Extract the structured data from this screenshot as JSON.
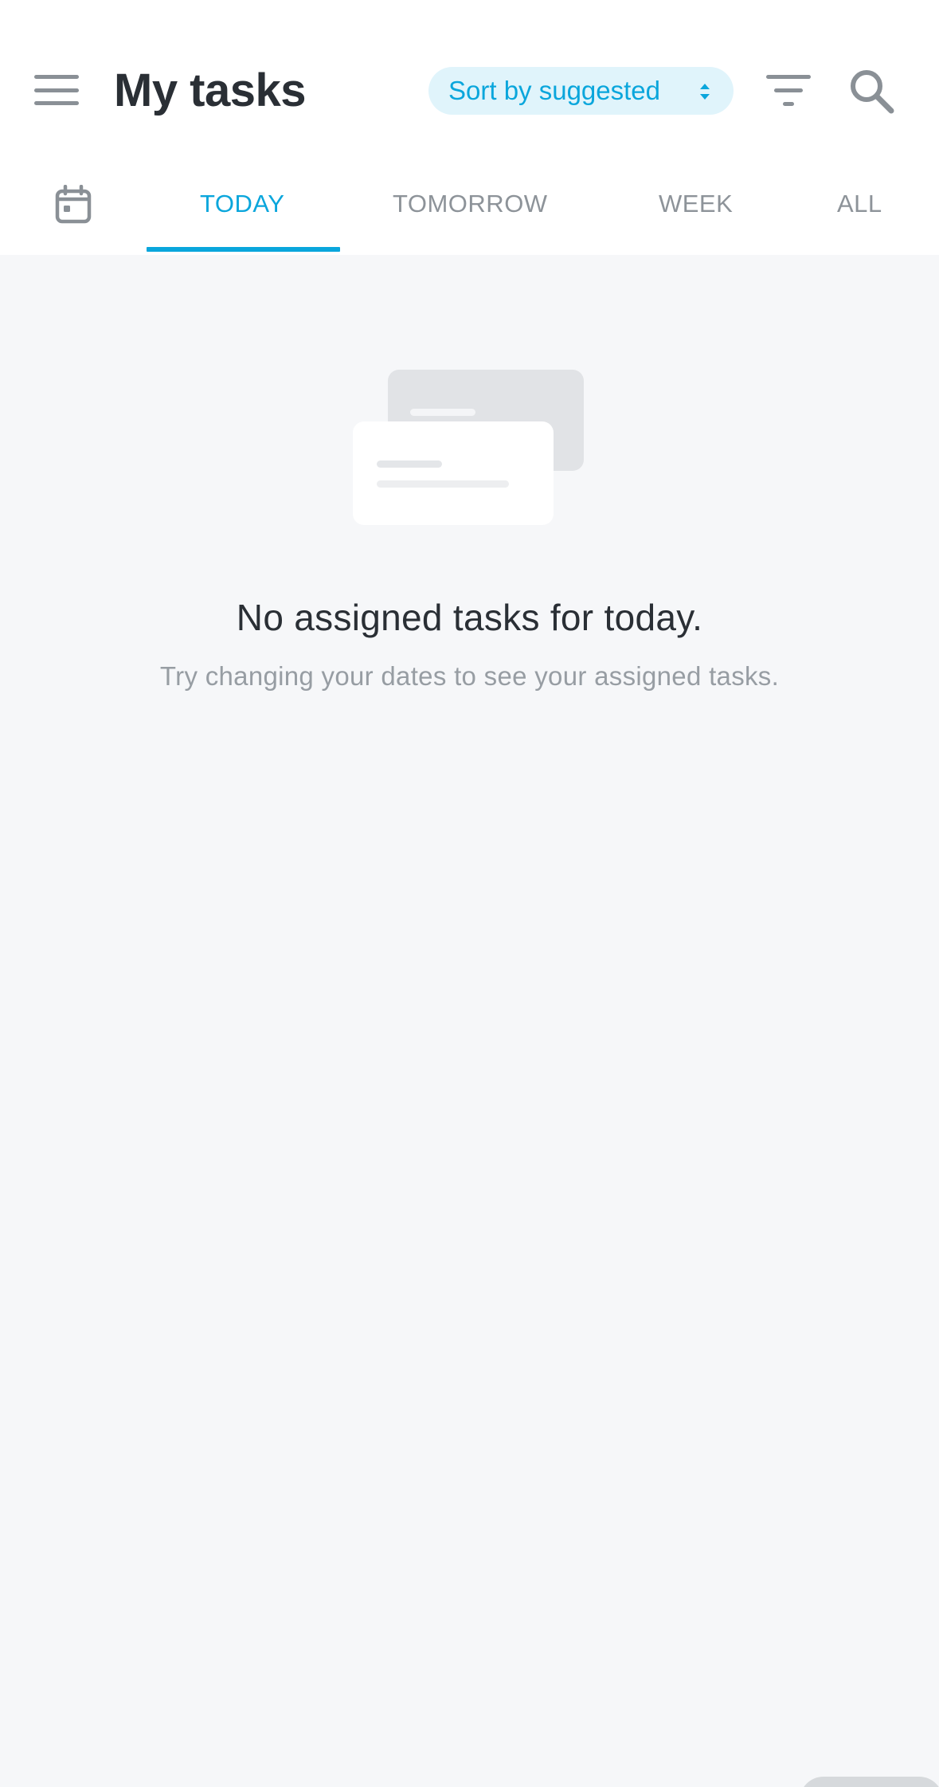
{
  "header": {
    "title": "My tasks",
    "sort_label": "Sort by suggested"
  },
  "tabs": [
    {
      "label": "TODAY",
      "active": true
    },
    {
      "label": "TOMORROW",
      "active": false
    },
    {
      "label": "WEEK",
      "active": false
    },
    {
      "label": "ALL",
      "active": false
    }
  ],
  "empty_state": {
    "title": "No assigned tasks for today.",
    "subtitle": "Try changing your dates to see your assigned tasks."
  },
  "icons": {
    "menu": "hamburger-menu-icon",
    "sort": "sort-arrows-icon",
    "filter": "filter-icon",
    "search": "search-icon",
    "calendar": "calendar-icon"
  },
  "colors": {
    "accent": "#0aa6dc",
    "accent_bg": "#e0f4fb",
    "title_text": "#2a2f35",
    "muted_text": "#8d9399",
    "background": "#f6f7f9"
  }
}
